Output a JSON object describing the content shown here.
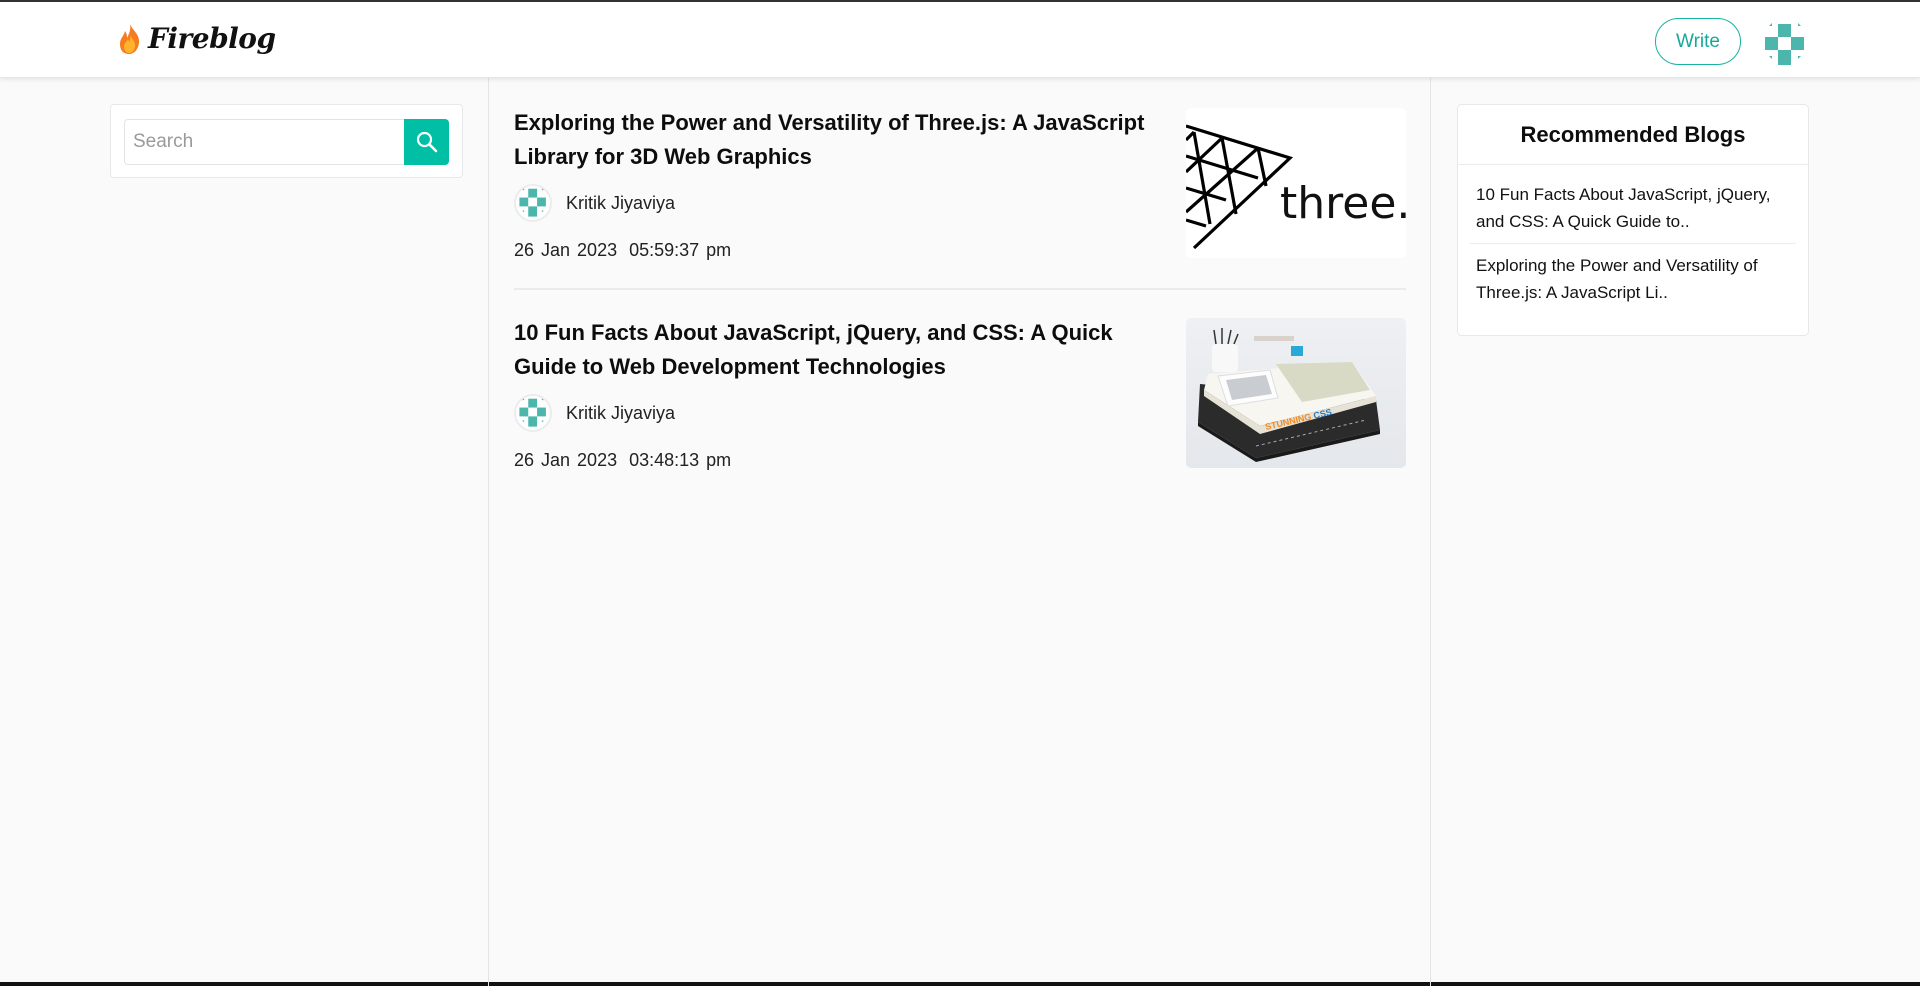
{
  "header": {
    "brand": "Fireblog",
    "logo_icon": "flame-icon",
    "write_label": "Write",
    "user_avatar_icon": "identicon-avatar"
  },
  "colors": {
    "accent": "#00bfa5",
    "avatar": "#4db6ac",
    "flame_outer": "#f57c20",
    "flame_inner": "#ffb32c"
  },
  "search": {
    "placeholder": "Search",
    "value": "",
    "button_icon": "search-icon"
  },
  "posts": [
    {
      "title": "Exploring the Power and Versatility of Three.js: A JavaScript Library for 3D Web Graphics",
      "author": "Kritik Jiyaviya",
      "date": "26 Jan 2023",
      "time": "05:59:37 pm",
      "thumbnail_text": "three.js",
      "thumbnail_alt": "three.js logo"
    },
    {
      "title": "10 Fun Facts About JavaScript, jQuery, and CSS: A Quick Guide to Web Development Technologies",
      "author": "Kritik Jiyaviya",
      "date": "26 Jan 2023",
      "time": "03:48:13 pm",
      "thumbnail_text": "STUNNING CSS",
      "thumbnail_alt": "books with phone on desk"
    }
  ],
  "recommended": {
    "title": "Recommended Blogs",
    "items": [
      {
        "label": "10 Fun Facts About JavaScript, jQuery, and CSS: A Quick Guide to.."
      },
      {
        "label": "Exploring the Power and Versatility of Three.js: A JavaScript Li.."
      }
    ]
  }
}
